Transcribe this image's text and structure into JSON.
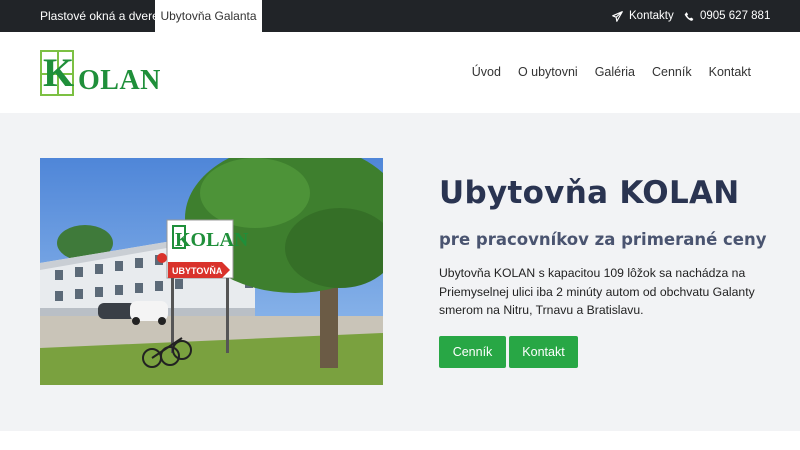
{
  "topbar": {
    "tabs": [
      {
        "label": "Plastové okná a dvere"
      },
      {
        "label": "Ubytovňa Galanta"
      }
    ],
    "contacts_label": "Kontakty",
    "phone": "0905 627 881",
    "icons": {
      "contacts": "paper-plane-icon",
      "phone": "phone-icon"
    }
  },
  "logo": {
    "k": "K",
    "rest": "OLAN",
    "alt": "KOLAN"
  },
  "nav": {
    "items": [
      {
        "label": "Úvod"
      },
      {
        "label": "O ubytovni"
      },
      {
        "label": "Galéria"
      },
      {
        "label": "Cenník"
      },
      {
        "label": "Kontakt"
      }
    ]
  },
  "hero": {
    "title": "Ubytovňa KOLAN",
    "subtitle": "pre pracovníkov za primerané ceny",
    "description": "Ubytovňa KOLAN s kapacitou 109 lôžok sa nachádza na Priemyselnej ulici iba 2 minúty autom od obchvatu Galanty smerom na Nitru, Trnavu a Bratislavu.",
    "buttons": [
      {
        "label": "Cenník"
      },
      {
        "label": "Kontakt"
      }
    ],
    "photo": {
      "sign_logo": "KOLAN",
      "sign_arrow": "UBYTOVŇA"
    }
  },
  "colors": {
    "topbar_bg": "#212428",
    "accent_green": "#28a745",
    "logo_green": "#1f8f3a",
    "title_navy": "#2a3451",
    "hero_bg": "#f2f3f5"
  }
}
